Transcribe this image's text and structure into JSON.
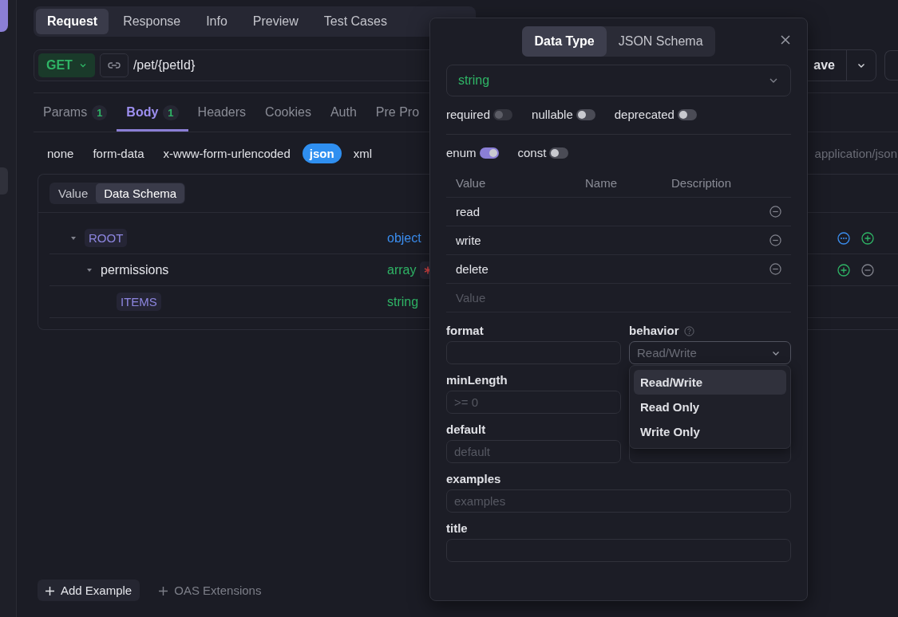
{
  "request_tabs": [
    {
      "label": "Request",
      "selected": true
    },
    {
      "label": "Response",
      "selected": false
    },
    {
      "label": "Info",
      "selected": false
    },
    {
      "label": "Preview",
      "selected": false
    },
    {
      "label": "Test Cases",
      "selected": false
    }
  ],
  "method": "GET",
  "url": "/pet/{petId}",
  "save_button": "ave",
  "param_tabs": [
    {
      "label": "Params",
      "count": "1",
      "selected": false
    },
    {
      "label": "Body",
      "count": "1",
      "selected": true
    },
    {
      "label": "Headers",
      "selected": false
    },
    {
      "label": "Cookies",
      "selected": false
    },
    {
      "label": "Auth",
      "selected": false
    },
    {
      "label": "Pre Pro",
      "selected": false
    }
  ],
  "body_types": [
    {
      "label": "none",
      "selected": false
    },
    {
      "label": "form-data",
      "selected": false
    },
    {
      "label": "x-www-form-urlencoded",
      "selected": false
    },
    {
      "label": "json",
      "selected": true
    },
    {
      "label": "xml",
      "selected": false
    }
  ],
  "content_type": "application/json",
  "schema_view_tabs": [
    {
      "label": "Value",
      "selected": false
    },
    {
      "label": "Data Schema",
      "selected": true
    }
  ],
  "schema_tree": [
    {
      "name": "ROOT",
      "kind": "tag",
      "type": "object",
      "color": "#3b8ef0",
      "required": false,
      "expanded": true,
      "children": [
        {
          "name": "permissions",
          "kind": "field",
          "type": "array",
          "color": "#2fb566",
          "required": true,
          "expanded": true,
          "children": [
            {
              "name": "ITEMS",
              "kind": "tag",
              "type": "string",
              "color": "#2fb566",
              "required": false
            }
          ]
        }
      ]
    }
  ],
  "footer": {
    "add_example": "Add Example",
    "oas_extensions": "OAS Extensions"
  },
  "popup": {
    "tabs": [
      {
        "label": "Data Type",
        "selected": true
      },
      {
        "label": "JSON Schema",
        "selected": false
      }
    ],
    "type": "string",
    "flags": [
      {
        "label": "required",
        "on": false,
        "disabled": true
      },
      {
        "label": "nullable",
        "on": false,
        "disabled": false
      },
      {
        "label": "deprecated",
        "on": false,
        "disabled": false
      }
    ],
    "enum_flags": [
      {
        "label": "enum",
        "on": true
      },
      {
        "label": "const",
        "on": false
      }
    ],
    "enum_columns": [
      "Value",
      "Name",
      "Description"
    ],
    "enum_rows": [
      {
        "value": "read"
      },
      {
        "value": "write"
      },
      {
        "value": "delete"
      }
    ],
    "new_value_placeholder": "Value",
    "format": {
      "label": "format"
    },
    "behavior": {
      "label": "behavior",
      "placeholder": "Read/Write"
    },
    "behavior_options": [
      {
        "label": "Read/Write",
        "selected": true
      },
      {
        "label": "Read Only",
        "selected": false
      },
      {
        "label": "Write Only",
        "selected": false
      }
    ],
    "min_length": {
      "label": "minLength",
      "placeholder": ">= 0"
    },
    "default": {
      "label": "default",
      "placeholder": "default"
    },
    "examples": {
      "label": "examples",
      "placeholder": "examples"
    },
    "title": {
      "label": "title"
    }
  }
}
